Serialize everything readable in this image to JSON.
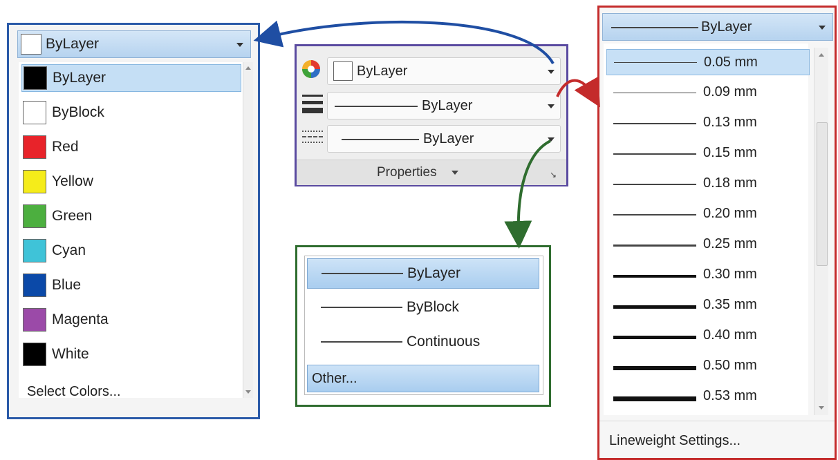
{
  "color_panel": {
    "header_label": "ByLayer",
    "items": [
      {
        "label": "ByLayer",
        "color": "#000000"
      },
      {
        "label": "ByBlock",
        "color": "#ffffff"
      },
      {
        "label": "Red",
        "color": "#e8232a"
      },
      {
        "label": "Yellow",
        "color": "#f5ec1a"
      },
      {
        "label": "Green",
        "color": "#4caf3f"
      },
      {
        "label": "Cyan",
        "color": "#3fc3d8"
      },
      {
        "label": "Blue",
        "color": "#0b49a8"
      },
      {
        "label": "Magenta",
        "color": "#9b4aa8"
      },
      {
        "label": "White",
        "color": "#000000"
      }
    ],
    "selected_index": 0,
    "footer": "Select Colors..."
  },
  "properties_panel": {
    "color_value": "ByLayer",
    "lineweight_value": "ByLayer",
    "linetype_value": "ByLayer",
    "title": "Properties"
  },
  "linetype_popup": {
    "items": [
      "ByLayer",
      "ByBlock",
      "Continuous"
    ],
    "other": "Other..."
  },
  "lineweight_panel": {
    "header_label": "ByLayer",
    "items": [
      "0.05 mm",
      "0.09 mm",
      "0.13 mm",
      "0.15 mm",
      "0.18 mm",
      "0.20 mm",
      "0.25 mm",
      "0.30 mm",
      "0.35 mm",
      "0.40 mm",
      "0.50 mm",
      "0.53 mm"
    ],
    "footer": "Lineweight Settings..."
  },
  "colors": {
    "color_panel_border": "#2b5aa8",
    "properties_border": "#5a4aa0",
    "linetype_border": "#2f6d2f",
    "lineweight_border": "#c42b2b",
    "selection": "#c5dff5"
  }
}
